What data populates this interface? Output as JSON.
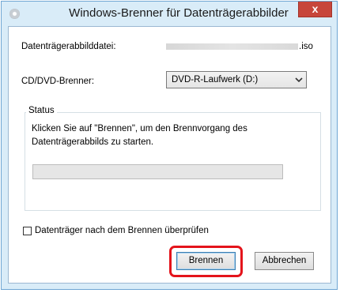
{
  "window": {
    "title": "Windows-Brenner für Datenträgerabbilder",
    "close_glyph": "x"
  },
  "form": {
    "file_label": "Datenträgerabbilddatei:",
    "file_extension": ".iso",
    "burner_label": "CD/DVD-Brenner:",
    "burner_selected": "DVD-R-Laufwerk (D:)"
  },
  "status": {
    "group_title": "Status",
    "message_line1": "Klicken Sie auf \"Brennen\", um den Brennvorgang des",
    "message_line2": "Datenträgerabbilds zu starten.",
    "progress": 0
  },
  "verify": {
    "label": "Datenträger nach dem Brennen überprüfen",
    "checked": false
  },
  "buttons": {
    "burn_label": "Brennen",
    "cancel_label": "Abbrechen"
  },
  "colors": {
    "highlight": "#e4141b",
    "close_button": "#c7463b",
    "window_frame": "#d9ecf8",
    "progress_fill": "#06b025"
  },
  "icons": {
    "app": "disc-icon",
    "dropdown": "chevron-down-icon",
    "close": "close-icon"
  }
}
